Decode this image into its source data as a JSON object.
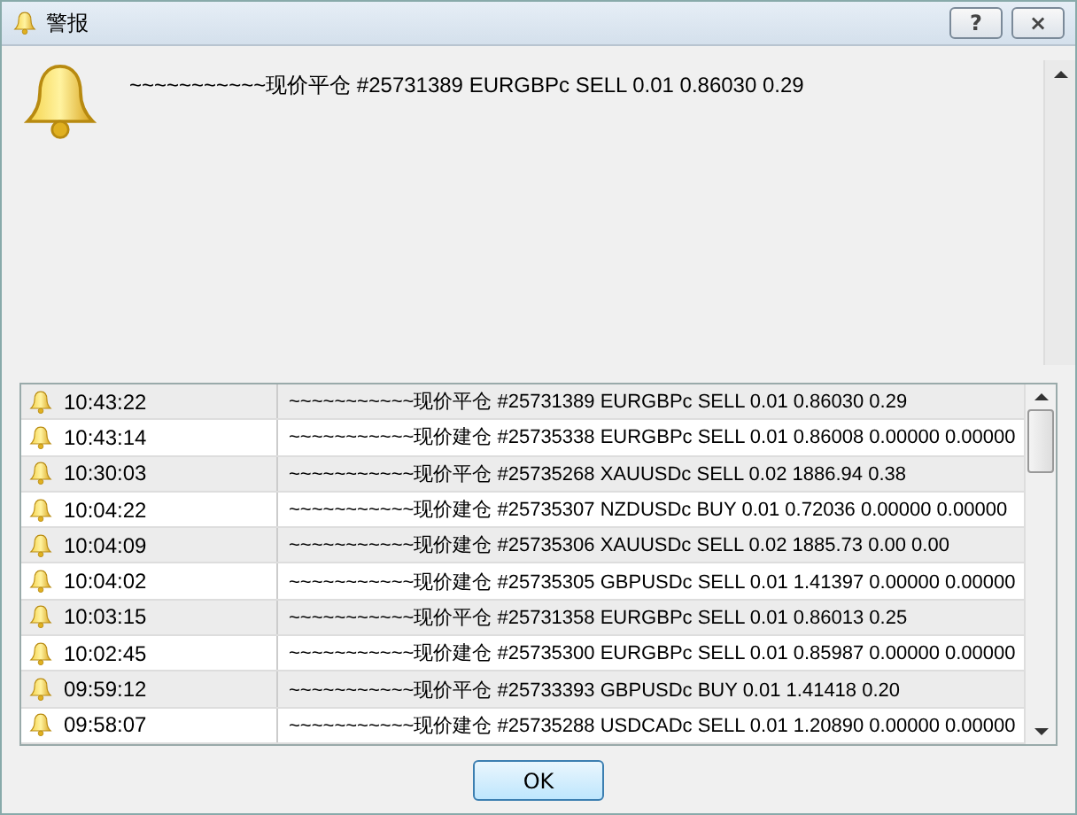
{
  "window": {
    "title": "警报"
  },
  "message": "~~~~~~~~~~~现价平仓 #25731389 EURGBPc SELL 0.01 0.86030 0.29",
  "alerts": [
    {
      "time": "10:43:22",
      "text": "~~~~~~~~~~~现价平仓 #25731389 EURGBPc SELL 0.01 0.86030 0.29"
    },
    {
      "time": "10:43:14",
      "text": "~~~~~~~~~~~现价建仓 #25735338 EURGBPc SELL 0.01 0.86008 0.00000 0.00000"
    },
    {
      "time": "10:30:03",
      "text": "~~~~~~~~~~~现价平仓 #25735268 XAUUSDc SELL 0.02 1886.94 0.38"
    },
    {
      "time": "10:04:22",
      "text": "~~~~~~~~~~~现价建仓 #25735307 NZDUSDc BUY 0.01 0.72036 0.00000 0.00000"
    },
    {
      "time": "10:04:09",
      "text": "~~~~~~~~~~~现价建仓 #25735306 XAUUSDc SELL 0.02 1885.73 0.00 0.00"
    },
    {
      "time": "10:04:02",
      "text": "~~~~~~~~~~~现价建仓 #25735305 GBPUSDc SELL 0.01 1.41397 0.00000 0.00000"
    },
    {
      "time": "10:03:15",
      "text": "~~~~~~~~~~~现价平仓 #25731358 EURGBPc SELL 0.01 0.86013 0.25"
    },
    {
      "time": "10:02:45",
      "text": "~~~~~~~~~~~现价建仓 #25735300 EURGBPc SELL 0.01 0.85987 0.00000 0.00000"
    },
    {
      "time": "09:59:12",
      "text": "~~~~~~~~~~~现价平仓 #25733393 GBPUSDc BUY 0.01 1.41418 0.20"
    },
    {
      "time": "09:58:07",
      "text": "~~~~~~~~~~~现价建仓 #25735288 USDCADc SELL 0.01 1.20890 0.00000 0.00000"
    }
  ],
  "buttons": {
    "help": "?",
    "close": "×",
    "ok": "OK"
  }
}
